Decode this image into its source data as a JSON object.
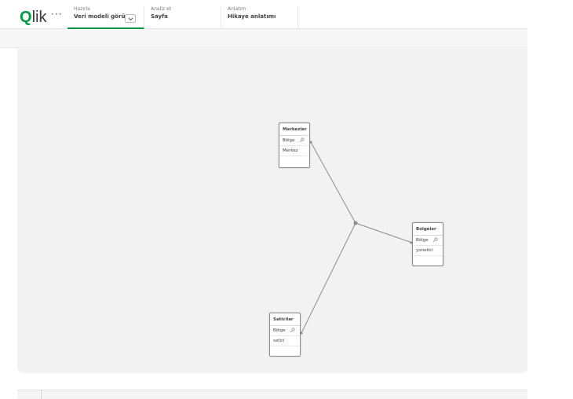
{
  "app": {
    "logo": "Qlik",
    "more": "···"
  },
  "nav": {
    "prepare": {
      "small": "Hazırla",
      "big": "Veri modeli görü..."
    },
    "analyze": {
      "small": "Analiz et",
      "big": "Sayfa"
    },
    "narrate": {
      "small": "Anlatım",
      "big": "Hikaye anlatımı"
    }
  },
  "tables": [
    {
      "name": "Merkezler",
      "fields": [
        "Bölge",
        "Merkez"
      ]
    },
    {
      "name": "Bolgeler",
      "fields": [
        "Bölge",
        "yonetici"
      ]
    },
    {
      "name": "Saticilar",
      "fields": [
        "Bölge",
        "satici"
      ]
    }
  ],
  "colors": {
    "accent": "#009845",
    "link": "#8c8c8c"
  }
}
